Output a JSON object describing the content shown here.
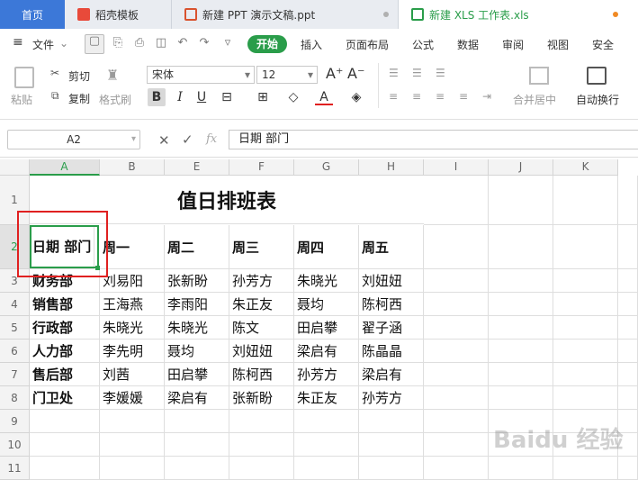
{
  "tabs": {
    "home": "首页",
    "template": "稻壳模板",
    "ppt": "新建 PPT 演示文稿.ppt",
    "xls": "新建 XLS 工作表.xls"
  },
  "menu": {
    "file": "文件",
    "start": "开始",
    "insert": "插入",
    "page_layout": "页面布局",
    "formula": "公式",
    "data": "数据",
    "review": "审阅",
    "view": "视图",
    "security": "安全"
  },
  "ribbon": {
    "paste": "粘贴",
    "cut": "剪切",
    "copy": "复制",
    "format_painter": "格式刷",
    "font_name": "宋体",
    "font_size": "12",
    "merge_center": "合并居中",
    "wrap_text": "自动换行"
  },
  "formula_bar": {
    "name_box": "A2",
    "fx": "fx",
    "content": "日期  部门"
  },
  "columns": [
    "A",
    "B",
    "E",
    "F",
    "G",
    "H",
    "I",
    "J",
    "K"
  ],
  "rows": [
    "1",
    "2",
    "3",
    "4",
    "5",
    "6",
    "7",
    "8",
    "9",
    "10",
    "11"
  ],
  "sheet": {
    "title": "值日排班表",
    "header": [
      "日期  部门",
      "周一",
      "周二",
      "周三",
      "周四",
      "周五"
    ],
    "data": [
      [
        "财务部",
        "刘易阳",
        "张新盼",
        "孙芳方",
        "朱晓光",
        "刘妞妞"
      ],
      [
        "销售部",
        "王海燕",
        "李雨阳",
        "朱正友",
        "聂均",
        "陈柯西"
      ],
      [
        "行政部",
        "朱晓光",
        "朱晓光",
        "陈文",
        "田启攀",
        "翟子涵"
      ],
      [
        "人力部",
        "李先明",
        "聂均",
        "刘妞妞",
        "梁启有",
        "陈晶晶"
      ],
      [
        "售后部",
        "刘茜",
        "田启攀",
        "陈柯西",
        "孙芳方",
        "梁启有"
      ],
      [
        "门卫处",
        "李媛媛",
        "梁启有",
        "张新盼",
        "朱正友",
        "孙芳方"
      ]
    ]
  },
  "watermark": "Baidu 经验",
  "colors": {
    "accent_green": "#2a9d4a",
    "tab_blue": "#3c78d8",
    "highlight_red": "#e02020"
  }
}
